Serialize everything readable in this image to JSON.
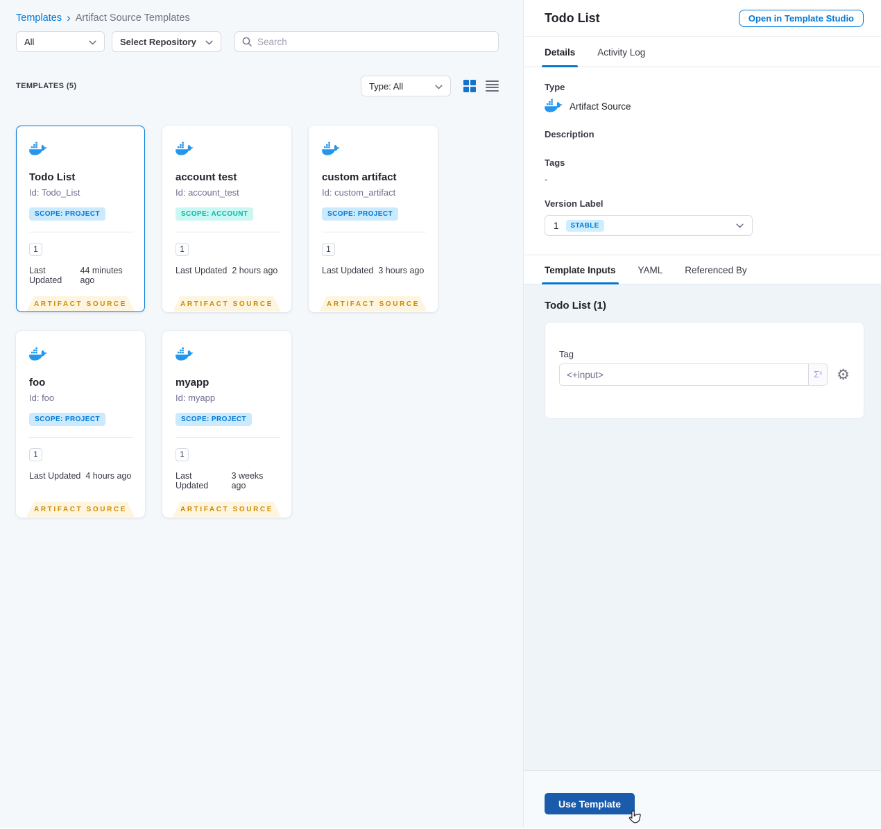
{
  "breadcrumb": {
    "root": "Templates",
    "separator": "›",
    "current": "Artifact Source Templates"
  },
  "filters": {
    "scope": "All",
    "repository": "Select Repository",
    "search_placeholder": "Search"
  },
  "list_header": {
    "count": "TEMPLATES (5)",
    "type_filter": "Type: All"
  },
  "cards": [
    {
      "title": "Todo List",
      "id": "Id: Todo_List",
      "scope_label": "SCOPE: PROJECT",
      "scope": "project",
      "versions": "1",
      "updated_label": "Last Updated",
      "updated": "44 minutes ago",
      "ribbon": "ARTIFACT SOURCE",
      "selected": true
    },
    {
      "title": "account test",
      "id": "Id: account_test",
      "scope_label": "SCOPE: ACCOUNT",
      "scope": "account",
      "versions": "1",
      "updated_label": "Last Updated",
      "updated": "2 hours ago",
      "ribbon": "ARTIFACT SOURCE",
      "selected": false
    },
    {
      "title": "custom artifact",
      "id": "Id: custom_artifact",
      "scope_label": "SCOPE: PROJECT",
      "scope": "project",
      "versions": "1",
      "updated_label": "Last Updated",
      "updated": "3 hours ago",
      "ribbon": "ARTIFACT SOURCE",
      "selected": false
    },
    {
      "title": "foo",
      "id": "Id: foo",
      "scope_label": "SCOPE: PROJECT",
      "scope": "project",
      "versions": "1",
      "updated_label": "Last Updated",
      "updated": "4 hours ago",
      "ribbon": "ARTIFACT SOURCE",
      "selected": false
    },
    {
      "title": "myapp",
      "id": "Id: myapp",
      "scope_label": "SCOPE: PROJECT",
      "scope": "project",
      "versions": "1",
      "updated_label": "Last Updated",
      "updated": "3 weeks ago",
      "ribbon": "ARTIFACT SOURCE",
      "selected": false
    }
  ],
  "panel": {
    "title": "Todo List",
    "open_button": "Open in Template Studio",
    "tab_details": "Details",
    "tab_activity": "Activity Log",
    "type_label": "Type",
    "type_value": "Artifact Source",
    "description_label": "Description",
    "tags_label": "Tags",
    "tags_value": "-",
    "version_label": "Version Label",
    "version_number": "1",
    "version_badge": "STABLE",
    "tab_inputs": "Template Inputs",
    "tab_yaml": "YAML",
    "tab_referenced": "Referenced By",
    "inputs_heading": "Todo List (1)",
    "tag_label": "Tag",
    "tag_value": "<+input>",
    "expression_symbol": "Σ",
    "expression_sup": "x",
    "gear_icon": "⚙",
    "use_button": "Use Template"
  },
  "colors": {
    "accent_blue": "#0278d5",
    "docker_blue": "#2496ed",
    "scope_project_bg": "#cbeafd",
    "scope_account_bg": "#cbf7f2",
    "scope_account_text": "#06b7aa",
    "ribbon_bg": "#fdf5df",
    "ribbon_text": "#cf8a00",
    "stable_badge_bg": "#cdeefe",
    "use_button_bg": "#1a5cab",
    "left_background": "#f4f8fb",
    "inputs_background": "#eff4f8"
  }
}
